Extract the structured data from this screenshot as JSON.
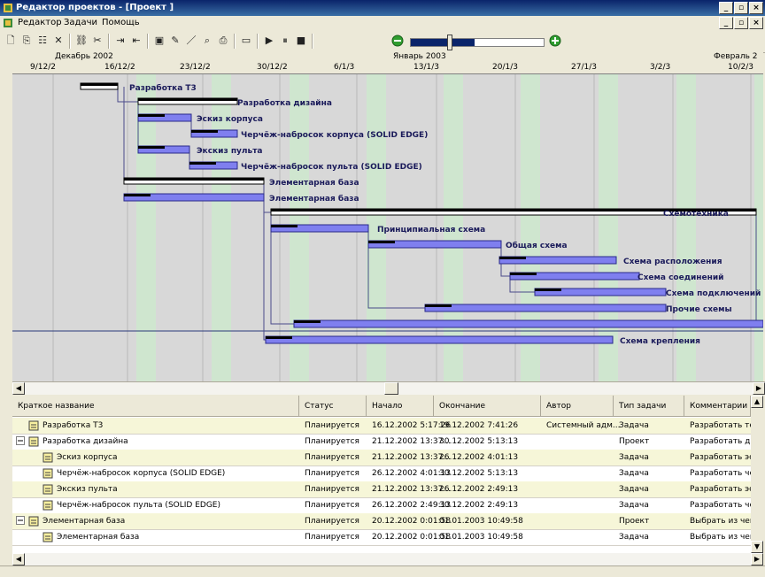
{
  "window": {
    "title": "Редактор проектов - [Проект ]"
  },
  "menu": {
    "items": [
      "Редактор",
      "Задачи",
      "Помощь"
    ]
  },
  "toolbar": {
    "zoom_level": 0.48
  },
  "timeline": {
    "months": [
      "Декабрь 2002",
      "Январь 2003",
      "Февраль 2"
    ],
    "dates": [
      "9/12/2",
      "16/12/2",
      "23/12/2",
      "30/12/2",
      "6/1/3",
      "13/1/3",
      "20/1/3",
      "27/1/3",
      "3/2/3",
      "10/2/3"
    ]
  },
  "gantt": {
    "tasks": [
      {
        "label": "Разработка Т3"
      },
      {
        "label": "Разработка дизайна"
      },
      {
        "label": "Эскиз корпуса"
      },
      {
        "label": "Черчёж-набросок корпуса (SOLID EDGE)"
      },
      {
        "label": "Экскиз пульта"
      },
      {
        "label": "Черчёж-набросок пульта (SOLID EDGE)"
      },
      {
        "label": "Элементарная база"
      },
      {
        "label": "Элементарная база"
      },
      {
        "label": "Схемотехника"
      },
      {
        "label": "Принципиальная схема"
      },
      {
        "label": "Общая схема"
      },
      {
        "label": "Схема расположения"
      },
      {
        "label": "Схема соединений"
      },
      {
        "label": "Схема подключений"
      },
      {
        "label": "Прочие схемы"
      },
      {
        "label": "Схема крепления"
      }
    ]
  },
  "table": {
    "columns": [
      "Краткое название",
      "Статус",
      "Начало",
      "Окончание",
      "Автор",
      "Тип задачи",
      "Комментарии"
    ],
    "rows": [
      {
        "name": "Разработка Т3",
        "status": "Планируется",
        "start": "16.12.2002 5:17:26",
        "end": "19.12.2002 7:41:26",
        "author": "Системный адм...",
        "type": "Задача",
        "comment": "Разработать тех"
      },
      {
        "name": "Разработка дизайна",
        "status": "Планируется",
        "start": "21.12.2002 13:37...",
        "end": "30.12.2002 5:13:13",
        "author": "",
        "type": "Проект",
        "comment": "Разработать диз"
      },
      {
        "name": "Эскиз корпуса",
        "status": "Планируется",
        "start": "21.12.2002 13:37...",
        "end": "26.12.2002 4:01:13",
        "author": "",
        "type": "Задача",
        "comment": "Разработать эск"
      },
      {
        "name": "Черчёж-набросок корпуса (SOLID EDGE)",
        "status": "Планируется",
        "start": "26.12.2002 4:01:13",
        "end": "30.12.2002 5:13:13",
        "author": "",
        "type": "Задача",
        "comment": "Разработать чер"
      },
      {
        "name": "Экскиз пульта",
        "status": "Планируется",
        "start": "21.12.2002 13:37...",
        "end": "26.12.2002 2:49:13",
        "author": "",
        "type": "Задача",
        "comment": "Разработать эск"
      },
      {
        "name": "Черчёж-набросок пульта (SOLID EDGE)",
        "status": "Планируется",
        "start": "26.12.2002 2:49:13",
        "end": "30.12.2002 2:49:13",
        "author": "",
        "type": "Задача",
        "comment": "Разработать чер"
      },
      {
        "name": "Элементарная база",
        "status": "Планируется",
        "start": "20.12.2002 0:01:58",
        "end": "01.01.2003 10:49:58",
        "author": "",
        "type": "Проект",
        "comment": "Выбрать из чего"
      },
      {
        "name": "Элементарная база",
        "status": "Планируется",
        "start": "20.12.2002 0:01:58",
        "end": "01.01.2003 10:49:58",
        "author": "",
        "type": "Задача",
        "comment": "Выбрать из чего"
      }
    ]
  }
}
